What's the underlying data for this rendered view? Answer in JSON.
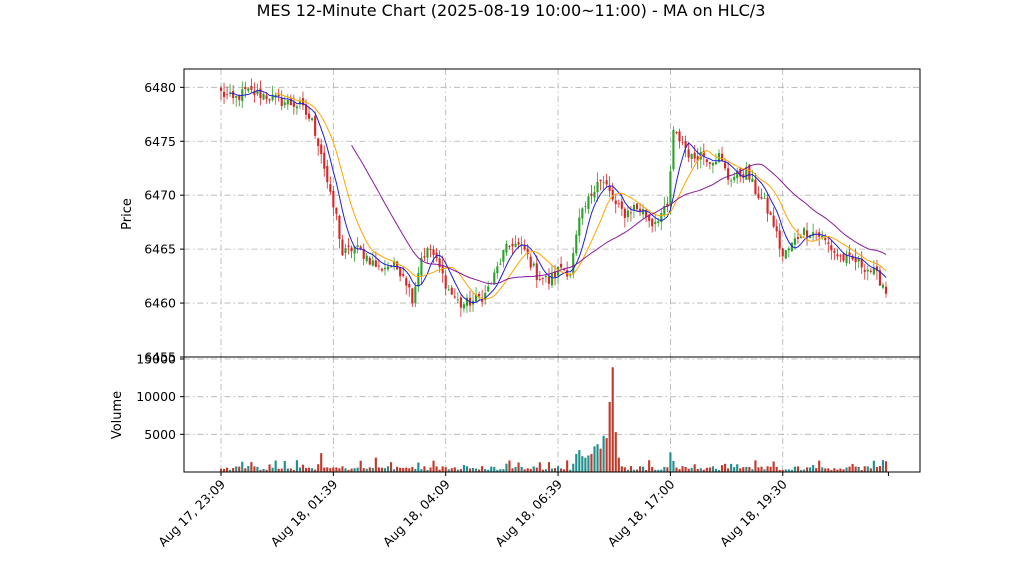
{
  "chart_data": {
    "type": "candlestick",
    "title": "MES 12-Minute Chart (2025-08-19 10:00~11:00) - MA on HLC/3",
    "price_panel": {
      "ylabel": "Price",
      "ylim": [
        6455,
        6481.7
      ],
      "yticks": [
        6455,
        6460,
        6465,
        6470,
        6475,
        6480
      ],
      "grid": true
    },
    "volume_panel": {
      "ylabel": "Volume",
      "ylim": [
        0,
        15000
      ],
      "yticks": [
        5000,
        10000,
        15000
      ],
      "grid": true
    },
    "bar_count": 220,
    "xticks": [
      {
        "bar": 0,
        "label": "Aug 17, 23:09"
      },
      {
        "bar": 37,
        "label": "Aug 18, 01:39"
      },
      {
        "bar": 74,
        "label": "Aug 18, 04:09"
      },
      {
        "bar": 111,
        "label": "Aug 18, 06:39"
      },
      {
        "bar": 148,
        "label": "Aug 18, 17:00"
      },
      {
        "bar": 185,
        "label": "Aug 18, 19:30"
      }
    ],
    "colors": {
      "up": "#2ca02c",
      "down": "#d62728",
      "volume_up": "#1f8f8f",
      "volume_down": "#c0392b",
      "ma_fast": "#1f1fd6",
      "ma_mid": "#ffa500",
      "ma_slow": "#8b1a9b"
    },
    "close_anchors": [
      [
        0,
        6479.5
      ],
      [
        4,
        6478.8
      ],
      [
        8,
        6479.6
      ],
      [
        14,
        6479.3
      ],
      [
        20,
        6478.7
      ],
      [
        26,
        6478.3
      ],
      [
        30,
        6476.8
      ],
      [
        33,
        6474.0
      ],
      [
        36,
        6469.8
      ],
      [
        38,
        6468.0
      ],
      [
        40,
        6464.5
      ],
      [
        44,
        6465.2
      ],
      [
        48,
        6464.3
      ],
      [
        52,
        6463.2
      ],
      [
        56,
        6463.6
      ],
      [
        60,
        6462.8
      ],
      [
        63,
        6460.5
      ],
      [
        66,
        6464.3
      ],
      [
        69,
        6465.0
      ],
      [
        72,
        6463.2
      ],
      [
        75,
        6461.2
      ],
      [
        79,
        6459.8
      ],
      [
        83,
        6460.2
      ],
      [
        87,
        6460.8
      ],
      [
        90,
        6462.5
      ],
      [
        93,
        6464.6
      ],
      [
        96,
        6465.6
      ],
      [
        100,
        6464.9
      ],
      [
        104,
        6462.6
      ],
      [
        108,
        6462.0
      ],
      [
        112,
        6463.4
      ],
      [
        115,
        6462.8
      ],
      [
        118,
        6467.6
      ],
      [
        121,
        6469.5
      ],
      [
        124,
        6471.5
      ],
      [
        127,
        6470.8
      ],
      [
        130,
        6469.0
      ],
      [
        133,
        6468.3
      ],
      [
        136,
        6468.9
      ],
      [
        139,
        6468.5
      ],
      [
        142,
        6467.4
      ],
      [
        145,
        6468.3
      ],
      [
        147,
        6468.7
      ],
      [
        149,
        6475.7
      ],
      [
        152,
        6474.9
      ],
      [
        155,
        6473.4
      ],
      [
        158,
        6473.9
      ],
      [
        161,
        6473.3
      ],
      [
        164,
        6473.6
      ],
      [
        167,
        6471.6
      ],
      [
        170,
        6471.8
      ],
      [
        173,
        6472.2
      ],
      [
        176,
        6470.4
      ],
      [
        179,
        6469.2
      ],
      [
        182,
        6467.3
      ],
      [
        185,
        6464.3
      ],
      [
        188,
        6465.4
      ],
      [
        191,
        6466.6
      ],
      [
        194,
        6466.7
      ],
      [
        197,
        6466.3
      ],
      [
        200,
        6465.4
      ],
      [
        203,
        6464.4
      ],
      [
        206,
        6464.0
      ],
      [
        209,
        6463.9
      ],
      [
        212,
        6463.4
      ],
      [
        215,
        6462.8
      ],
      [
        218,
        6461.8
      ],
      [
        219,
        6461.0
      ]
    ],
    "volume_spikes": [
      [
        117,
        2400
      ],
      [
        118,
        2900
      ],
      [
        119,
        2100
      ],
      [
        120,
        1900
      ],
      [
        121,
        2200
      ],
      [
        122,
        2400
      ],
      [
        123,
        3400
      ],
      [
        124,
        3700
      ],
      [
        125,
        3100
      ],
      [
        126,
        4800
      ],
      [
        127,
        4500
      ],
      [
        128,
        9300
      ],
      [
        129,
        13900
      ],
      [
        130,
        5300
      ],
      [
        131,
        1900
      ],
      [
        148,
        2600
      ],
      [
        33,
        2500
      ],
      [
        51,
        1900
      ],
      [
        70,
        1500
      ],
      [
        182,
        1400
      ]
    ],
    "moving_averages": [
      {
        "key": "ma_fast",
        "period": 6,
        "start": 3
      },
      {
        "key": "ma_mid",
        "period": 12,
        "start": 18
      },
      {
        "key": "ma_slow",
        "period": 30,
        "start": 43
      }
    ]
  }
}
